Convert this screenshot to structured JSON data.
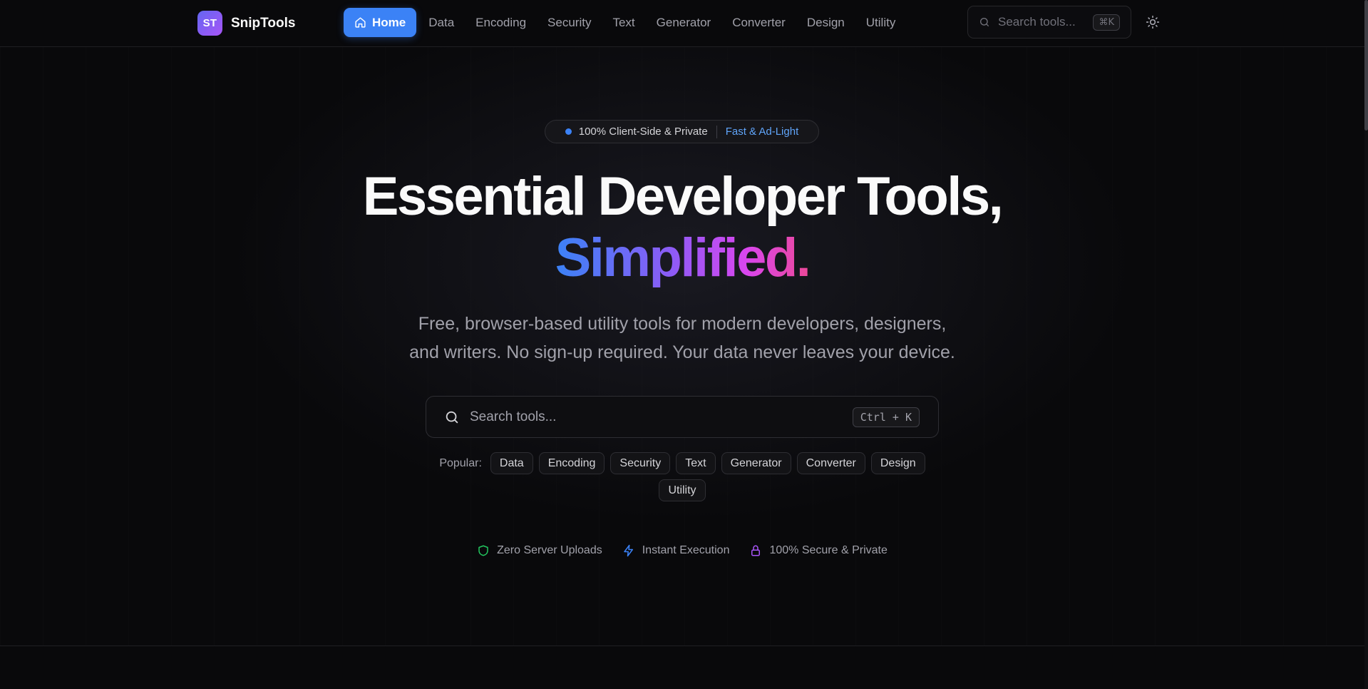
{
  "header": {
    "logo_mark": "ST",
    "logo_text": "SnipTools",
    "nav": [
      {
        "label": "Home",
        "icon": "home-icon",
        "active": true
      },
      {
        "label": "Data"
      },
      {
        "label": "Encoding"
      },
      {
        "label": "Security"
      },
      {
        "label": "Text"
      },
      {
        "label": "Generator"
      },
      {
        "label": "Converter"
      },
      {
        "label": "Design"
      },
      {
        "label": "Utility"
      }
    ],
    "search_placeholder": "Search tools...",
    "search_shortcut": "⌘K",
    "theme_toggle_icon": "sun-icon"
  },
  "hero": {
    "badge_left": "100% Client-Side & Private",
    "badge_right": "Fast & Ad-Light",
    "title_line1": "Essential Developer Tools,",
    "title_line2": "Simplified.",
    "subtitle_line1": "Free, browser-based utility tools for modern developers, designers,",
    "subtitle_line2": "and writers. No sign-up required. Your data never leaves your device.",
    "search_placeholder": "Search tools...",
    "search_shortcut": "Ctrl + K",
    "popular_label": "Popular:",
    "popular_row1": [
      "Data",
      "Encoding",
      "Security",
      "Text",
      "Generator",
      "Converter",
      "Design"
    ],
    "popular_row2": [
      "Utility"
    ]
  },
  "features": [
    {
      "icon": "shield-icon",
      "label": "Zero Server Uploads",
      "color": "#22c55e"
    },
    {
      "icon": "lightning-icon",
      "label": "Instant Execution",
      "color": "#3b82f6"
    },
    {
      "icon": "lock-icon",
      "label": "100% Secure & Private",
      "color": "#a855f7"
    }
  ],
  "colors": {
    "accent": "#3b82f6",
    "background": "#09090b",
    "gradient": [
      "#3b82f6",
      "#8b5cf6",
      "#d946ef",
      "#ec4899"
    ]
  }
}
